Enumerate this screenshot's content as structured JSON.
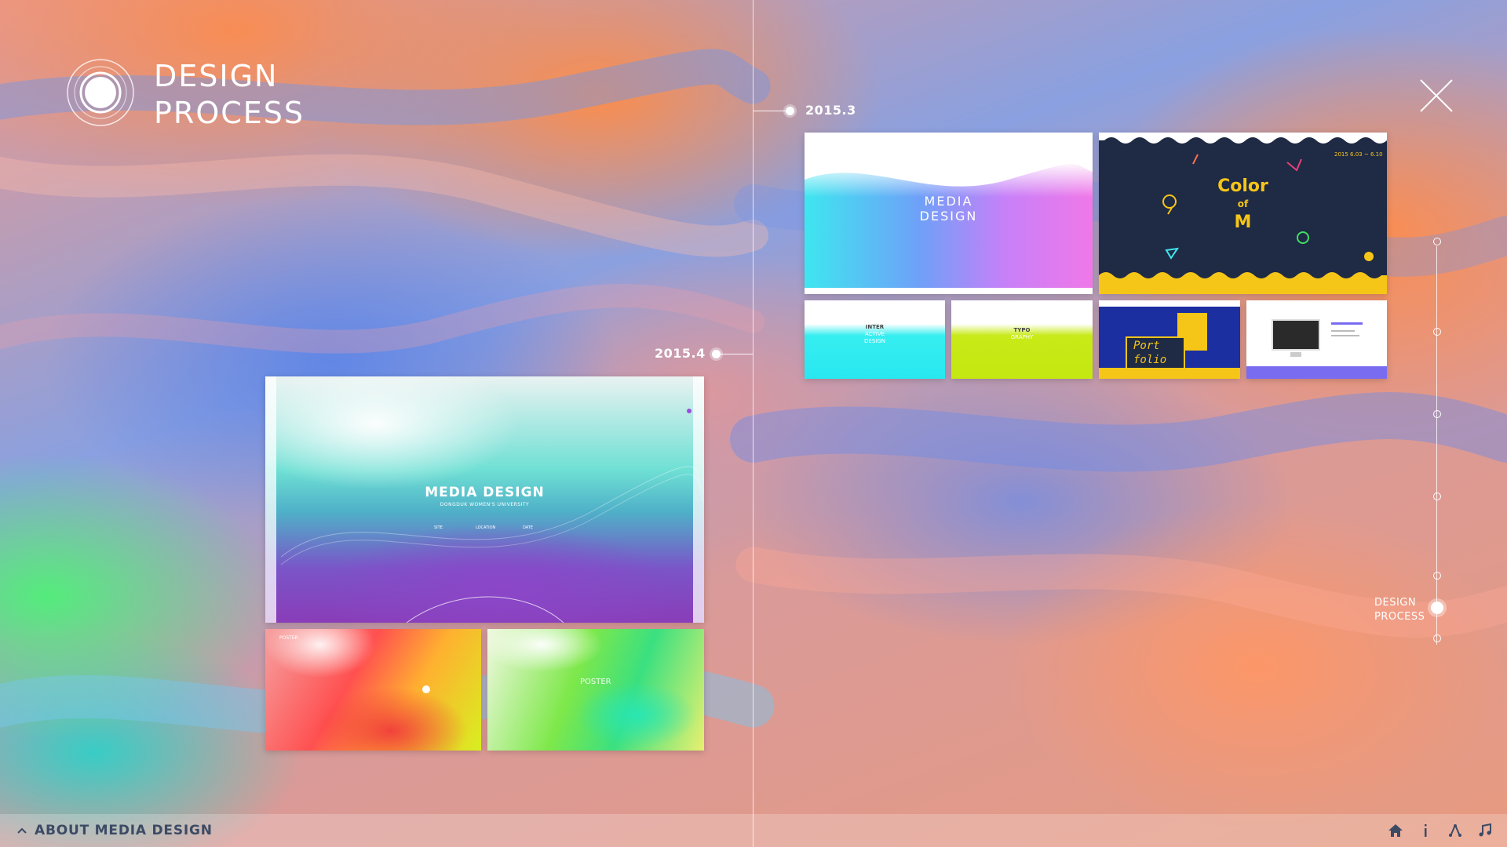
{
  "header": {
    "title_line1": "DESIGN",
    "title_line2": "PROCESS"
  },
  "timeline": {
    "marker_right": "2015.3",
    "marker_left": "2015.4"
  },
  "thumbnails": {
    "left_main": {
      "title": "MEDIA DESIGN",
      "subtitle": "DONGDUK WOMEN'S UNIVERSITY",
      "info": [
        "SITE",
        "LOCATION",
        "DATE"
      ]
    },
    "left_small_1": {
      "label": "POSTER"
    },
    "left_small_2": {
      "label": "POSTER"
    },
    "right_1": {
      "title_line1": "MEDIA",
      "title_line2": "DESIGN"
    },
    "right_2": {
      "line1": "Color",
      "line2": "of",
      "line3": "M",
      "date": "2015 6.03 ~ 6.10"
    },
    "right_3": {
      "line1": "INTER",
      "line2": "ACTIVE",
      "line3": "DESIGN"
    },
    "right_4": {
      "line1": "TYPO",
      "line2": "GRAPHY"
    },
    "right_5": {
      "line1": "Port",
      "line2": "folio"
    }
  },
  "side_nav": {
    "active_label_line1": "DESIGN",
    "active_label_line2": "PROCESS"
  },
  "footer": {
    "about_label": "ABOUT MEDIA DESIGN",
    "icons": [
      "home-icon",
      "info-icon",
      "share-icon",
      "music-icon"
    ]
  },
  "colors": {
    "accent_yellow": "#f5c518",
    "navy": "#1f2a44",
    "text_dark": "#3c4a64"
  }
}
